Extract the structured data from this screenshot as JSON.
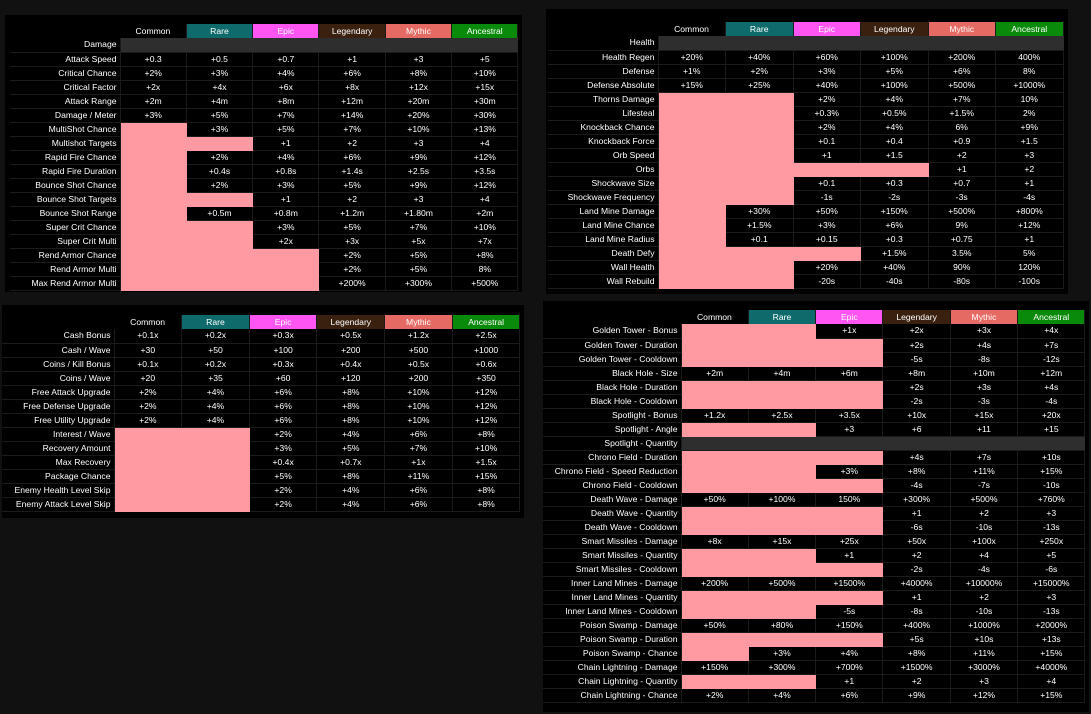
{
  "tiers": [
    {
      "name": "Common",
      "bg": "#000000",
      "fg": "#ffffff"
    },
    {
      "name": "Rare",
      "bg": "#0f6b6b",
      "fg": "#ffffff"
    },
    {
      "name": "Epic",
      "bg": "#ff55f2",
      "fg": "#ffffff"
    },
    {
      "name": "Legendary",
      "bg": "#3a200e",
      "fg": "#ffffff"
    },
    {
      "name": "Mythic",
      "bg": "#e46a63",
      "fg": "#ffffff"
    },
    {
      "name": "Ancestral",
      "bg": "#0a8a0a",
      "fg": "#ffffff"
    }
  ],
  "colors": {
    "locked": "#ff9aa2",
    "section": "#2e2e2e",
    "background": "#111111",
    "panel": "#000000"
  },
  "tables": [
    {
      "id": "damage",
      "rows": [
        {
          "label": "Damage",
          "section": true
        },
        {
          "label": "Attack Speed",
          "values": [
            "+0.3",
            "+0.5",
            "+0.7",
            "+1",
            "+3",
            "+5"
          ]
        },
        {
          "label": "Critical Chance",
          "values": [
            "+2%",
            "+3%",
            "+4%",
            "+6%",
            "+8%",
            "+10%"
          ]
        },
        {
          "label": "Critical Factor",
          "values": [
            "+2x",
            "+4x",
            "+6x",
            "+8x",
            "+12x",
            "+15x"
          ]
        },
        {
          "label": "Attack Range",
          "values": [
            "+2m",
            "+4m",
            "+8m",
            "+12m",
            "+20m",
            "+30m"
          ]
        },
        {
          "label": "Damage / Meter",
          "values": [
            "+3%",
            "+5%",
            "+7%",
            "+14%",
            "+20%",
            "+30%"
          ]
        },
        {
          "label": "MultiShot Chance",
          "values": [
            null,
            "+3%",
            "+5%",
            "+7%",
            "+10%",
            "+13%"
          ]
        },
        {
          "label": "Multishot Targets",
          "values": [
            null,
            null,
            "+1",
            "+2",
            "+3",
            "+4"
          ]
        },
        {
          "label": "Rapid Fire Chance",
          "values": [
            null,
            "+2%",
            "+4%",
            "+6%",
            "+9%",
            "+12%"
          ]
        },
        {
          "label": "Rapid Fire Duration",
          "values": [
            null,
            "+0.4s",
            "+0.8s",
            "+1.4s",
            "+2.5s",
            "+3.5s"
          ]
        },
        {
          "label": "Bounce Shot Chance",
          "values": [
            null,
            "+2%",
            "+3%",
            "+5%",
            "+9%",
            "+12%"
          ]
        },
        {
          "label": "Bounce Shot Targets",
          "values": [
            null,
            null,
            "+1",
            "+2",
            "+3",
            "+4"
          ]
        },
        {
          "label": "Bounce Shot Range",
          "values": [
            null,
            "+0.5m",
            "+0.8m",
            "+1.2m",
            "+1.80m",
            "+2m"
          ]
        },
        {
          "label": "Super Crit Chance",
          "values": [
            null,
            null,
            "+3%",
            "+5%",
            "+7%",
            "+10%"
          ]
        },
        {
          "label": "Super Crit Multi",
          "values": [
            null,
            null,
            "+2x",
            "+3x",
            "+5x",
            "+7x"
          ]
        },
        {
          "label": "Rend Armor Chance",
          "values": [
            null,
            null,
            null,
            "+2%",
            "+5%",
            "+8%"
          ]
        },
        {
          "label": "Rend Armor Multi",
          "values": [
            null,
            null,
            null,
            "+2%",
            "+5%",
            "8%"
          ]
        },
        {
          "label": "Max Rend Armor Multi",
          "values": [
            null,
            null,
            null,
            "+200%",
            "+300%",
            "+500%"
          ]
        }
      ]
    },
    {
      "id": "health",
      "rows": [
        {
          "label": "Health",
          "section": true
        },
        {
          "label": "Health Regen",
          "values": [
            "+20%",
            "+40%",
            "+60%",
            "+100%",
            "+200%",
            "400%"
          ]
        },
        {
          "label": "Defense",
          "values": [
            "+1%",
            "+2%",
            "+3%",
            "+5%",
            "+6%",
            "8%"
          ]
        },
        {
          "label": "Defense Absolute",
          "values": [
            "+15%",
            "+25%",
            "+40%",
            "+100%",
            "+500%",
            "+1000%"
          ]
        },
        {
          "label": "Thorns Damage",
          "values": [
            null,
            null,
            "+2%",
            "+4%",
            "+7%",
            "10%"
          ]
        },
        {
          "label": "Lifesteal",
          "values": [
            null,
            null,
            "+0.3%",
            "+0.5%",
            "+1.5%",
            "2%"
          ]
        },
        {
          "label": "Knockback Chance",
          "values": [
            null,
            null,
            "+2%",
            "+4%",
            "6%",
            "+9%"
          ]
        },
        {
          "label": "Knockback Force",
          "values": [
            null,
            null,
            "+0.1",
            "+0.4",
            "+0.9",
            "+1.5"
          ]
        },
        {
          "label": "Orb Speed",
          "values": [
            null,
            null,
            "+1",
            "+1.5",
            "+2",
            "+3"
          ]
        },
        {
          "label": "Orbs",
          "values": [
            null,
            null,
            null,
            null,
            "+1",
            "+2"
          ]
        },
        {
          "label": "Shockwave Size",
          "values": [
            null,
            null,
            "+0.1",
            "+0.3",
            "+0.7",
            "+1"
          ]
        },
        {
          "label": "Shockwave Frequency",
          "values": [
            null,
            null,
            "-1s",
            "-2s",
            "-3s",
            "-4s"
          ]
        },
        {
          "label": "Land Mine Damage",
          "values": [
            null,
            "+30%",
            "+50%",
            "+150%",
            "+500%",
            "+800%"
          ]
        },
        {
          "label": "Land Mine Chance",
          "values": [
            null,
            "+1.5%",
            "+3%",
            "+6%",
            "9%",
            "+12%"
          ]
        },
        {
          "label": "Land Mine Radius",
          "values": [
            null,
            "+0.1",
            "+0.15",
            "+0.3",
            "+0.75",
            "+1"
          ]
        },
        {
          "label": "Death Defy",
          "values": [
            null,
            null,
            null,
            "+1.5%",
            "3.5%",
            "5%"
          ]
        },
        {
          "label": "Wall Health",
          "values": [
            null,
            null,
            "+20%",
            "+40%",
            "90%",
            "120%"
          ]
        },
        {
          "label": "Wall Rebuild",
          "values": [
            null,
            null,
            "-20s",
            "-40s",
            "-80s",
            "-100s"
          ]
        }
      ]
    },
    {
      "id": "utility",
      "rows": [
        {
          "label": "Cash Bonus",
          "values": [
            "+0.1x",
            "+0.2x",
            "+0.3x",
            "+0.5x",
            "+1.2x",
            "+2.5x"
          ]
        },
        {
          "label": "Cash / Wave",
          "values": [
            "+30",
            "+50",
            "+100",
            "+200",
            "+500",
            "+1000"
          ]
        },
        {
          "label": "Coins / Kill Bonus",
          "values": [
            "+0.1x",
            "+0.2x",
            "+0.3x",
            "+0.4x",
            "+0.5x",
            "+0.6x"
          ]
        },
        {
          "label": "Coins / Wave",
          "values": [
            "+20",
            "+35",
            "+60",
            "+120",
            "+200",
            "+350"
          ]
        },
        {
          "label": "Free Attack Upgrade",
          "values": [
            "+2%",
            "+4%",
            "+6%",
            "+8%",
            "+10%",
            "+12%"
          ]
        },
        {
          "label": "Free Defense Upgrade",
          "values": [
            "+2%",
            "+4%",
            "+6%",
            "+8%",
            "+10%",
            "+12%"
          ]
        },
        {
          "label": "Free Utility Upgrade",
          "values": [
            "+2%",
            "+4%",
            "+6%",
            "+8%",
            "+10%",
            "+12%"
          ]
        },
        {
          "label": "Interest / Wave",
          "values": [
            null,
            null,
            "+2%",
            "+4%",
            "+6%",
            "+8%"
          ]
        },
        {
          "label": "Recovery Amount",
          "values": [
            null,
            null,
            "+3%",
            "+5%",
            "+7%",
            "+10%"
          ]
        },
        {
          "label": "Max Recovery",
          "values": [
            null,
            null,
            "+0.4x",
            "+0.7x",
            "+1x",
            "+1.5x"
          ]
        },
        {
          "label": "Package Chance",
          "values": [
            null,
            null,
            "+5%",
            "+8%",
            "+11%",
            "+15%"
          ]
        },
        {
          "label": "Enemy Health Level Skip",
          "values": [
            null,
            null,
            "+2%",
            "+4%",
            "+6%",
            "+8%"
          ]
        },
        {
          "label": "Enemy Attack Level Skip",
          "values": [
            null,
            null,
            "+2%",
            "+4%",
            "+6%",
            "+8%"
          ]
        }
      ]
    },
    {
      "id": "ultimate",
      "rows": [
        {
          "label": "Golden Tower - Bonus",
          "values": [
            null,
            null,
            "+1x",
            "+2x",
            "+3x",
            "+4x"
          ]
        },
        {
          "label": "Golden Tower - Duration",
          "values": [
            null,
            null,
            null,
            "+2s",
            "+4s",
            "+7s"
          ]
        },
        {
          "label": "Golden Tower - Cooldown",
          "values": [
            null,
            null,
            null,
            "-5s",
            "-8s",
            "-12s"
          ]
        },
        {
          "label": "Black Hole - Size",
          "values": [
            "+2m",
            "+4m",
            "+6m",
            "+8m",
            "+10m",
            "+12m"
          ]
        },
        {
          "label": "Black Hole - Duration",
          "values": [
            null,
            null,
            null,
            "+2s",
            "+3s",
            "+4s"
          ]
        },
        {
          "label": "Black Hole - Cooldown",
          "values": [
            null,
            null,
            null,
            "-2s",
            "-3s",
            "-4s"
          ]
        },
        {
          "label": "Spotlight - Bonus",
          "values": [
            "+1.2x",
            "+2.5x",
            "+3.5x",
            "+10x",
            "+15x",
            "+20x"
          ]
        },
        {
          "label": "Spotlight - Angle",
          "values": [
            null,
            null,
            "+3",
            "+6",
            "+11",
            "+15"
          ]
        },
        {
          "label": "Spotlight - Quantity",
          "section": true
        },
        {
          "label": "Chrono Field - Duration",
          "values": [
            null,
            null,
            null,
            "+4s",
            "+7s",
            "+10s"
          ]
        },
        {
          "label": "Chrono Field - Speed Reduction",
          "values": [
            null,
            null,
            "+3%",
            "+8%",
            "+11%",
            "+15%"
          ]
        },
        {
          "label": "Chrono Field - Cooldown",
          "values": [
            null,
            null,
            null,
            "-4s",
            "-7s",
            "-10s"
          ]
        },
        {
          "label": "Death Wave - Damage",
          "values": [
            "+50%",
            "+100%",
            "150%",
            "+300%",
            "+500%",
            "+760%"
          ]
        },
        {
          "label": "Death Wave - Quantity",
          "values": [
            null,
            null,
            null,
            "+1",
            "+2",
            "+3"
          ]
        },
        {
          "label": "Death Wave - Cooldown",
          "values": [
            null,
            null,
            null,
            "-6s",
            "-10s",
            "-13s"
          ]
        },
        {
          "label": "Smart Missiles - Damage",
          "values": [
            "+8x",
            "+15x",
            "+25x",
            "+50x",
            "+100x",
            "+250x"
          ]
        },
        {
          "label": "Smart Missiles - Quantity",
          "values": [
            null,
            null,
            "+1",
            "+2",
            "+4",
            "+5"
          ]
        },
        {
          "label": "Smart Missiles - Cooldown",
          "values": [
            null,
            null,
            null,
            "-2s",
            "-4s",
            "-6s"
          ]
        },
        {
          "label": "Inner Land Mines - Damage",
          "values": [
            "+200%",
            "+500%",
            "+1500%",
            "+4000%",
            "+10000%",
            "+15000%"
          ]
        },
        {
          "label": "Inner Land Mines - Quantity",
          "values": [
            null,
            null,
            null,
            "+1",
            "+2",
            "+3"
          ]
        },
        {
          "label": "Inner Land Mines - Cooldown",
          "values": [
            null,
            null,
            "-5s",
            "-8s",
            "-10s",
            "-13s"
          ]
        },
        {
          "label": "Poison Swamp - Damage",
          "values": [
            "+50%",
            "+80%",
            "+150%",
            "+400%",
            "+1000%",
            "+2000%"
          ]
        },
        {
          "label": "Poison Swamp - Duration",
          "values": [
            null,
            null,
            null,
            "+5s",
            "+10s",
            "+13s"
          ]
        },
        {
          "label": "Poison Swamp - Chance",
          "values": [
            null,
            "+3%",
            "+4%",
            "+8%",
            "+11%",
            "+15%"
          ]
        },
        {
          "label": "Chain Lightning - Damage",
          "values": [
            "+150%",
            "+300%",
            "+700%",
            "+1500%",
            "+3000%",
            "+4000%"
          ]
        },
        {
          "label": "Chain Lightning - Quantity",
          "values": [
            null,
            null,
            "+1",
            "+2",
            "+3",
            "+4"
          ]
        },
        {
          "label": "Chain Lightning - Chance",
          "values": [
            "+2%",
            "+4%",
            "+6%",
            "+9%",
            "+12%",
            "+15%"
          ]
        }
      ]
    }
  ]
}
